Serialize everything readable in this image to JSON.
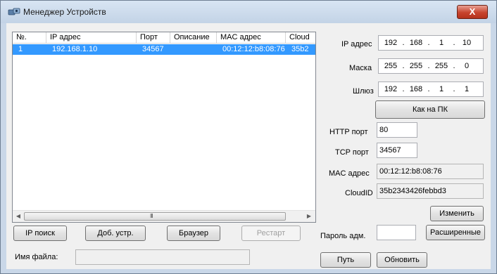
{
  "window": {
    "title": "Менеджер Устройств",
    "close_label": "X"
  },
  "list": {
    "columns": [
      "№.",
      "IP адрес",
      "Порт",
      "Описание",
      "MAC адрес",
      "Cloud"
    ],
    "rows": [
      {
        "num": "1",
        "ip": "192.168.1.10",
        "port": "34567",
        "desc": "",
        "mac": "00:12:12:b8:08:76",
        "cloud": "35b2"
      }
    ],
    "scroll_grip": "III"
  },
  "bottom": {
    "ip_search": "IP поиск",
    "add_device": "Доб. устр.",
    "browser": "Браузер",
    "restart": "Рестарт",
    "filename_label": "Имя файла:",
    "filename_value": ""
  },
  "settings": {
    "ip_label": "IP адрес",
    "ip": [
      "192",
      "168",
      "1",
      "10"
    ],
    "mask_label": "Маска",
    "mask": [
      "255",
      "255",
      "255",
      "0"
    ],
    "gateway_label": "Шлюз",
    "gateway": [
      "192",
      "168",
      "1",
      "1"
    ],
    "as_pc": "Как на ПК",
    "http_label": "HTTP порт",
    "http_port": "80",
    "tcp_label": "TCP порт",
    "tcp_port": "34567",
    "mac_label": "MAC адрес",
    "mac": "00:12:12:b8:08:76",
    "cloud_label": "CloudID",
    "cloud": "35b2343426febbd3",
    "change": "Изменить",
    "admin_pwd_label": "Пароль адм.",
    "advanced": "Расширенные",
    "path": "Путь",
    "refresh": "Обновить"
  }
}
